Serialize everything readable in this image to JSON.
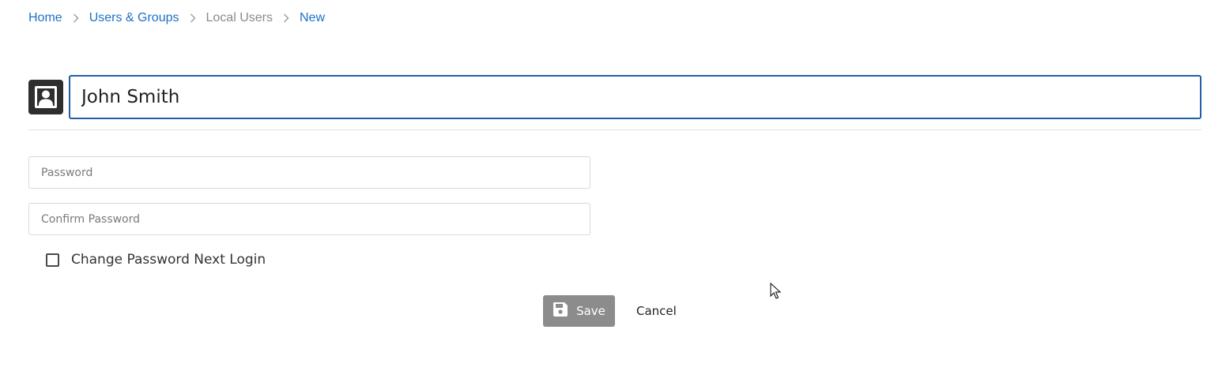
{
  "breadcrumb": {
    "items": [
      {
        "label": "Home"
      },
      {
        "label": "Users & Groups"
      },
      {
        "label": "Local Users"
      },
      {
        "label": "New"
      }
    ]
  },
  "header": {
    "avatar_icon": "user-card-icon",
    "name_value": "John Smith"
  },
  "form": {
    "password_placeholder": "Password",
    "confirm_password_placeholder": "Confirm Password",
    "change_password_label": "Change Password Next Login",
    "change_password_checked": false
  },
  "actions": {
    "save_label": "Save",
    "save_icon": "floppy-disk-icon",
    "cancel_label": "Cancel"
  },
  "colors": {
    "link": "#1f6fc4",
    "input_focus_border": "#1f5fa8",
    "save_button_bg": "#8c8c8c",
    "avatar_bg": "#2e2e2e"
  }
}
